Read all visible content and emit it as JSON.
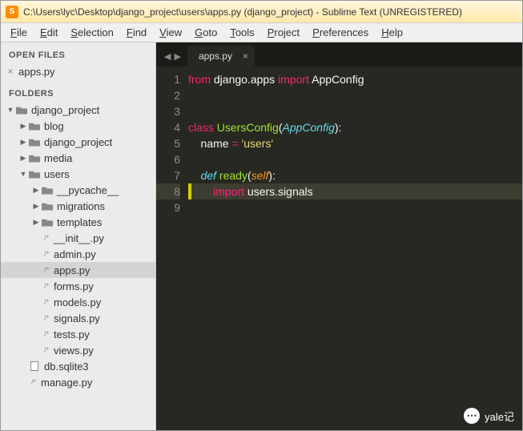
{
  "title": "C:\\Users\\lyc\\Desktop\\django_project\\users\\apps.py (django_project) - Sublime Text (UNREGISTERED)",
  "menu": [
    "File",
    "Edit",
    "Selection",
    "Find",
    "View",
    "Goto",
    "Tools",
    "Project",
    "Preferences",
    "Help"
  ],
  "sidebar": {
    "open_files_header": "OPEN FILES",
    "open_files": [
      {
        "label": "apps.py"
      }
    ],
    "folders_header": "FOLDERS",
    "tree": [
      {
        "depth": 0,
        "arrow": "down",
        "icon": "folder",
        "label": "django_project"
      },
      {
        "depth": 1,
        "arrow": "right",
        "icon": "folder",
        "label": "blog"
      },
      {
        "depth": 1,
        "arrow": "right",
        "icon": "folder",
        "label": "django_project"
      },
      {
        "depth": 1,
        "arrow": "right",
        "icon": "folder",
        "label": "media"
      },
      {
        "depth": 1,
        "arrow": "down",
        "icon": "folder",
        "label": "users"
      },
      {
        "depth": 2,
        "arrow": "right",
        "icon": "folder",
        "label": "__pycache__"
      },
      {
        "depth": 2,
        "arrow": "right",
        "icon": "folder",
        "label": "migrations"
      },
      {
        "depth": 2,
        "arrow": "right",
        "icon": "folder",
        "label": "templates"
      },
      {
        "depth": 2,
        "arrow": "none",
        "icon": "file",
        "ftype": "/*",
        "label": "__init__.py"
      },
      {
        "depth": 2,
        "arrow": "none",
        "icon": "file",
        "ftype": "/*",
        "label": "admin.py"
      },
      {
        "depth": 2,
        "arrow": "none",
        "icon": "file",
        "ftype": "/*",
        "label": "apps.py",
        "active": true
      },
      {
        "depth": 2,
        "arrow": "none",
        "icon": "file",
        "ftype": "/*",
        "label": "forms.py"
      },
      {
        "depth": 2,
        "arrow": "none",
        "icon": "file",
        "ftype": "/*",
        "label": "models.py"
      },
      {
        "depth": 2,
        "arrow": "none",
        "icon": "file",
        "ftype": "/*",
        "label": "signals.py"
      },
      {
        "depth": 2,
        "arrow": "none",
        "icon": "file",
        "ftype": "/*",
        "label": "tests.py"
      },
      {
        "depth": 2,
        "arrow": "none",
        "icon": "file",
        "ftype": "/*",
        "label": "views.py"
      },
      {
        "depth": 1,
        "arrow": "none",
        "icon": "doc",
        "label": "db.sqlite3"
      },
      {
        "depth": 1,
        "arrow": "none",
        "icon": "file",
        "ftype": "/*",
        "label": "manage.py"
      }
    ]
  },
  "tab": {
    "label": "apps.py"
  },
  "code": {
    "lines": [
      {
        "n": 1,
        "t": [
          [
            "kw",
            "from"
          ],
          [
            "mod",
            " django.apps "
          ],
          [
            "kw",
            "import"
          ],
          [
            "mod",
            " AppConfig"
          ]
        ]
      },
      {
        "n": 2,
        "t": []
      },
      {
        "n": 3,
        "t": []
      },
      {
        "n": 4,
        "t": [
          [
            "kw",
            "class"
          ],
          [
            "mod",
            " "
          ],
          [
            "cls",
            "UsersConfig"
          ],
          [
            "punc",
            "("
          ],
          [
            "type",
            "AppConfig"
          ],
          [
            "punc",
            "):"
          ]
        ]
      },
      {
        "n": 5,
        "t": [
          [
            "mod",
            "    name "
          ],
          [
            "kw",
            "="
          ],
          [
            "mod",
            " "
          ],
          [
            "str",
            "'users'"
          ]
        ]
      },
      {
        "n": 6,
        "t": []
      },
      {
        "n": 7,
        "t": [
          [
            "mod",
            "    "
          ],
          [
            "type",
            "def"
          ],
          [
            "mod",
            " "
          ],
          [
            "func",
            "ready"
          ],
          [
            "punc",
            "("
          ],
          [
            "param",
            "self"
          ],
          [
            "punc",
            "):"
          ]
        ]
      },
      {
        "n": 8,
        "hl": true,
        "t": [
          [
            "mod",
            "        "
          ],
          [
            "kw",
            "import"
          ],
          [
            "mod",
            " users.signals"
          ]
        ]
      },
      {
        "n": 9,
        "t": []
      }
    ]
  },
  "watermark": "yale记"
}
